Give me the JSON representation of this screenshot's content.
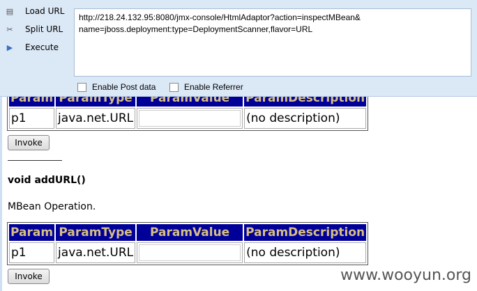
{
  "toolbar": {
    "load": "Load URL",
    "split": "Split URL",
    "execute": "Execute",
    "url": "http://218.24.132.95:8080/jmx-console/HtmlAdaptor?action=inspectMBean&\nname=jboss.deployment:type=DeploymentScanner,flavor=URL",
    "post": "Enable Post data",
    "referrer": "Enable Referrer"
  },
  "headers": [
    "Param",
    "ParamType",
    "ParamValue",
    "ParamDescription"
  ],
  "op1": {
    "row": [
      "p1",
      "java.net.URL",
      "(no description)"
    ],
    "invoke": "Invoke"
  },
  "op2": {
    "signature": "void addURL()",
    "description": "MBean Operation.",
    "row": [
      "p1",
      "java.net.URL",
      "(no description)"
    ],
    "invoke": "Invoke"
  },
  "watermark": "www.wooyun.org"
}
